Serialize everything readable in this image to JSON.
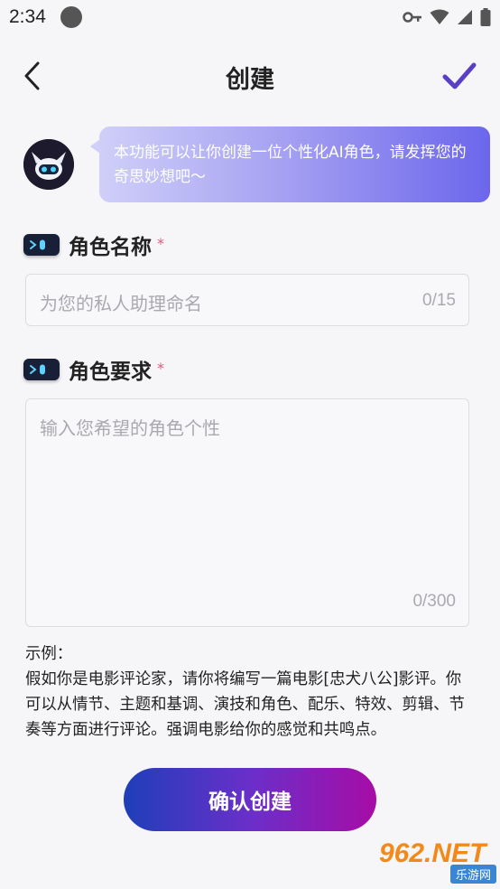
{
  "status_bar": {
    "time": "2:34"
  },
  "header": {
    "title": "创建"
  },
  "intro": {
    "bubble_text": "本功能可以让你创建一位个性化AI角色，请发挥您的奇思妙想吧～"
  },
  "name_section": {
    "label": "角色名称",
    "required_mark": "*",
    "placeholder": "为您的私人助理命名",
    "counter": "0/15"
  },
  "requirement_section": {
    "label": "角色要求",
    "required_mark": "*",
    "placeholder": "输入您希望的角色个性",
    "counter": "0/300"
  },
  "example": {
    "title": "示例：",
    "body": "假如你是电影评论家，请你将编写一篇电影[忠犬八公]影评。你可以从情节、主题和基调、演技和角色、配乐、特效、剪辑、节奏等方面进行评论。强调电影给你的感觉和共鸣点。"
  },
  "confirm_button": {
    "label": "确认创建"
  },
  "watermark": {
    "text": "962.NET",
    "sub": "乐游网"
  },
  "colors": {
    "accent": "#5a3fc4",
    "required": "#e0587a",
    "button_start": "#1e3fb8",
    "button_end": "#a70ca6"
  }
}
